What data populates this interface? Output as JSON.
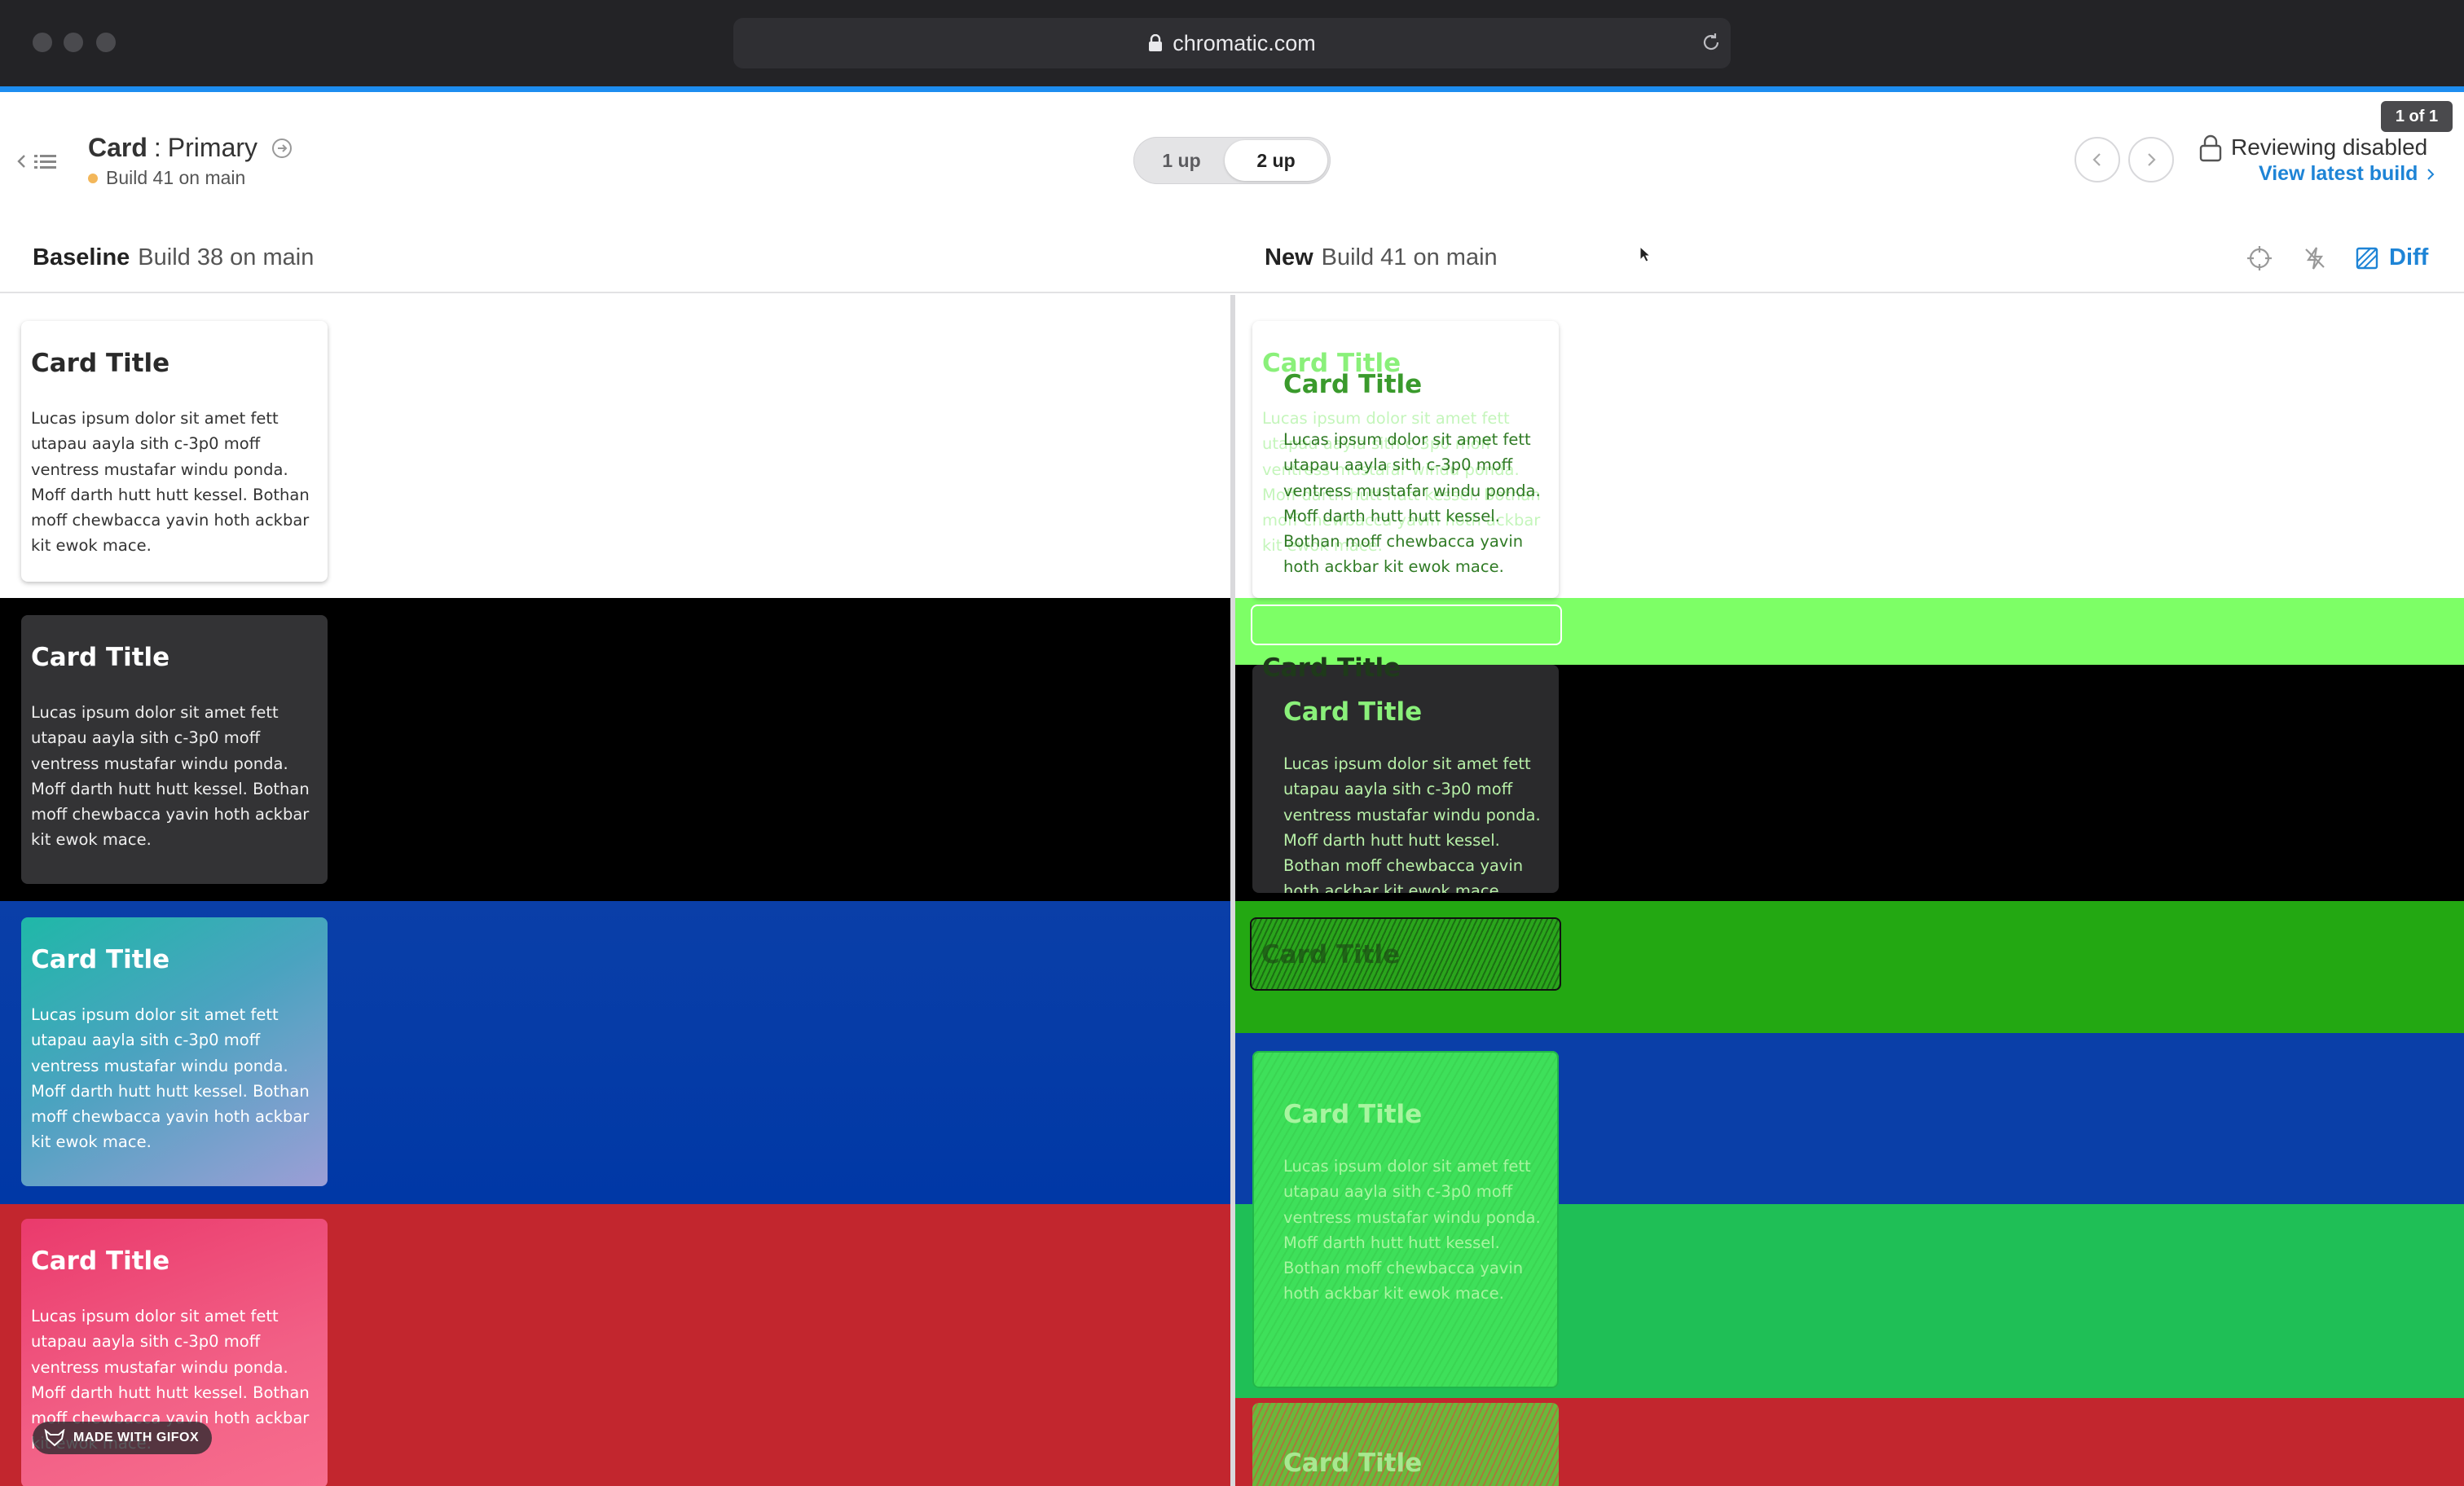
{
  "browser": {
    "url": "chromatic.com"
  },
  "header": {
    "component": "Card",
    "separator": ":",
    "story": "Primary",
    "build_status": "Build 41 on main",
    "mode_toggle": {
      "one_up": "1 up",
      "two_up": "2 up",
      "selected": "2 up"
    },
    "reviewing": "Reviewing disabled",
    "latest_link": "View latest build",
    "counter": "1 of 1"
  },
  "compare": {
    "baseline_label": "Baseline",
    "baseline_build": "Build 38 on main",
    "new_label": "New",
    "new_build": "Build 41 on main",
    "diff_label": "Diff"
  },
  "cards": {
    "title": "Card Title",
    "body": "Lucas ipsum dolor sit amet fett utapau aayla sith c-3p0 moff ventress mustafar windu ponda. Moff darth hutt hutt kessel. Bothan moff chewbacca yavin hoth ackbar kit ewok mace.",
    "variants": [
      "white",
      "dark",
      "teal-gradient",
      "pink-gradient"
    ]
  },
  "watermark": "MADE WITH GIFOX",
  "colors": {
    "accent": "#1d8df0",
    "link": "#1e84d6",
    "status_dot": "#f3b75a",
    "diff_green": "#7dff66",
    "band_dark": "#000000",
    "band_blue": "#0a3fa8",
    "band_red": "#c2262e"
  },
  "icons": [
    "plus-icon",
    "lock-icon",
    "reload-icon",
    "chevron-left-icon",
    "list-icon",
    "arrow-circle-icon",
    "chevron-right-icon",
    "crosshair-icon",
    "strobe-off-icon",
    "diff-icon",
    "fox-icon"
  ]
}
